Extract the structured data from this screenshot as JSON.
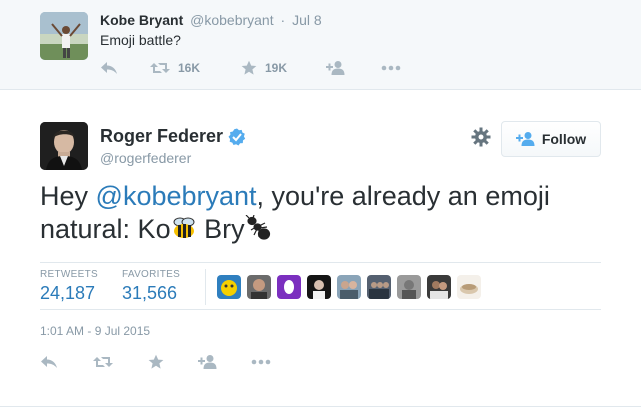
{
  "parent_tweet": {
    "name": "Kobe Bryant",
    "handle": "@kobebryant",
    "separator": "·",
    "time": "Jul 8",
    "text": "Emoji battle?",
    "retweets": "16K",
    "favorites": "19K"
  },
  "main_tweet": {
    "name": "Roger Federer",
    "handle": "@rogerfederer",
    "text_prefix": "Hey ",
    "mention": "@kobebryant",
    "text_middle": ", you're already an emoji natural: Ko",
    "text_between": " Bry",
    "follow_label": "Follow",
    "stats": {
      "retweets_label": "RETWEETS",
      "retweets_value": "24,187",
      "favorites_label": "FAVORITES",
      "favorites_value": "31,566"
    },
    "date": "1:01 AM - 9 Jul 2015"
  },
  "icons": [
    "reply-icon",
    "retweet-icon",
    "star-icon",
    "follow-icon",
    "more-icon",
    "gear-icon",
    "verified-icon",
    "bee-emoji-icon",
    "ant-emoji-icon"
  ],
  "colors": {
    "link": "#2b7bb9",
    "verified": "#55acee",
    "muted": "#8899a6",
    "text": "#292f33",
    "border": "#e1e8ed"
  }
}
